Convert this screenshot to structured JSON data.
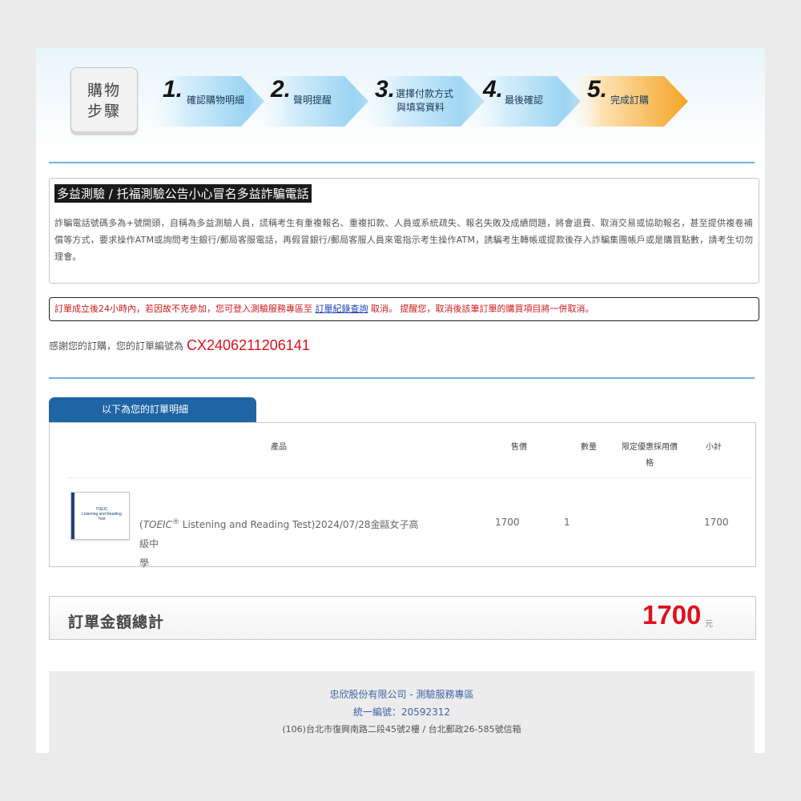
{
  "steps": {
    "label_line1": "購物",
    "label_line2": "步驟",
    "items": [
      {
        "num": "1.",
        "line1": "確認購物明細",
        "line2": ""
      },
      {
        "num": "2.",
        "line1": "聲明提醒",
        "line2": ""
      },
      {
        "num": "3.",
        "line1": "選擇付款方式",
        "line2": "與填寫資料"
      },
      {
        "num": "4.",
        "line1": "最後確認",
        "line2": ""
      },
      {
        "num": "5.",
        "line1": "完成訂購",
        "line2": ""
      }
    ]
  },
  "notice": {
    "title": "多益測驗 / 托福測驗公告小心冒名多益詐騙電話",
    "body": "詐騙電話號碼多為+號開頭，自稱為多益測驗人員，謊稱考生有重複報名、重複扣款、人員或系統疏失、報名失敗及成績問題，將會退費、取消交易或協助報名，甚至提供複卷補償等方式，要求操作ATM或詢問考生銀行/郵局客服電話，再假冒銀行/郵局客服人員來電指示考生操作ATM，誘騙考生轉帳或提款後存入詐騙集團帳戶或是購買點數，請考生切勿理會。"
  },
  "alert": {
    "text_before": "訂單成立後24小時內，若因故不克參加，您可登入測驗服務專區至 ",
    "link": "訂單紀錄查詢",
    "text_after": " 取消。 提醒您，取消後該筆訂單的購買項目將一併取消。"
  },
  "thanks": {
    "text": "感謝您的訂購，您的訂單編號為",
    "order_number": "CX2406211206141"
  },
  "details": {
    "tab_label": "以下為您的訂單明細",
    "headers": {
      "product": "產品",
      "price": "售價",
      "qty": "數量",
      "discount_line1": "限定優惠採用價",
      "discount_line2": "格",
      "subtotal": "小計"
    },
    "rows": [
      {
        "thumb_line1": "TOEIC",
        "thumb_line2": "Listening and Reading",
        "thumb_line3": "Test",
        "name_prefix": "(",
        "name_brand": "TOEIC",
        "name_reg": "®",
        "name_line1_rest": " Listening and Reading Test)2024/07/28金甌女子高級中",
        "name_line2": "學",
        "price": "1700",
        "qty": "1",
        "discount": "",
        "subtotal": "1700"
      }
    ]
  },
  "total": {
    "label": "訂單金額總計",
    "value": "1700",
    "unit": "元"
  },
  "footer": {
    "line1": "忠欣股份有限公司 - 測驗服務專區",
    "line2": "統一編號：20592312",
    "line3": "(106)台北市復興南路二段45號2樓  /  台北郵政26-585號信箱"
  },
  "colors": {
    "accent_blue": "#1f64a5",
    "step_blue": "#8fcdf0",
    "step_active_orange": "#f4a325",
    "price_red": "#e0101b"
  }
}
